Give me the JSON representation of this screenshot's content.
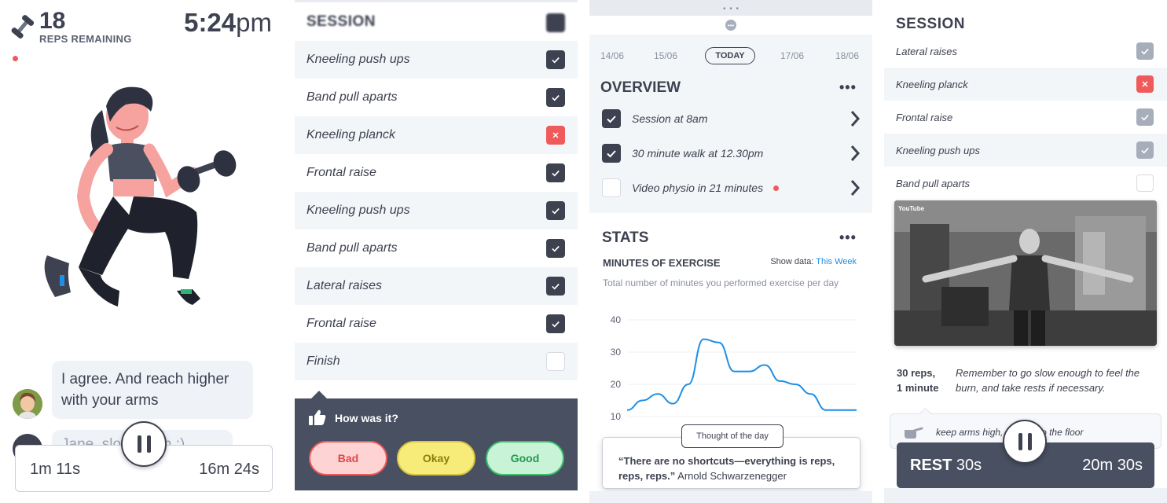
{
  "panel1": {
    "reps_count": "18",
    "reps_label": "REPS REMAINING",
    "time_main": "5:24",
    "time_suffix": "pm",
    "chat": {
      "message1": "I agree. And reach higher with your arms",
      "message2": "Jane, slow down :)"
    },
    "timer_left": "1m 11s",
    "timer_right": "16m 24s"
  },
  "panel2": {
    "title": "SESSION",
    "items": [
      {
        "label": "Kneeling push ups",
        "state": "checked"
      },
      {
        "label": "Band pull aparts",
        "state": "checked"
      },
      {
        "label": "Kneeling planck",
        "state": "failed"
      },
      {
        "label": "Frontal raise",
        "state": "checked"
      },
      {
        "label": "Kneeling push ups",
        "state": "checked"
      },
      {
        "label": "Band pull aparts",
        "state": "checked"
      },
      {
        "label": "Lateral raises",
        "state": "checked"
      },
      {
        "label": "Frontal raise",
        "state": "checked"
      },
      {
        "label": "Finish",
        "state": "unchecked"
      }
    ],
    "feedback": {
      "question": "How was it?",
      "bad": "Bad",
      "okay": "Okay",
      "good": "Good"
    }
  },
  "panel3": {
    "dates": [
      "14/06",
      "15/06",
      "TODAY",
      "17/06",
      "18/06"
    ],
    "overview_title": "OVERVIEW",
    "overview_items": [
      {
        "label": "Session at 8am",
        "checked": true
      },
      {
        "label": "30 minute walk at 12.30pm",
        "checked": true
      },
      {
        "label": "Video physio in 21 minutes",
        "checked": false,
        "alert": true
      }
    ],
    "stats_title": "STATS",
    "metric_title": "MINUTES OF EXERCISE",
    "show_data_label": "Show data:",
    "show_data_value": "This Week",
    "chart_description": "Total number of minutes you performed exercise per day",
    "thought_label": "Thought of the day",
    "quote_text": "“There are no shortcuts—everything is reps, reps, reps.”",
    "quote_author": "Arnold Schwarzenegger",
    "chart_data": {
      "type": "line",
      "title": "",
      "xlabel": "",
      "ylabel": "",
      "y_ticks": [
        40,
        30,
        20,
        10
      ],
      "ylim": [
        10,
        40
      ],
      "grid": true,
      "color": "#1d8fe6",
      "x": [
        0,
        1,
        2,
        3,
        4,
        5,
        6,
        7,
        8,
        9,
        10,
        11,
        12,
        13,
        14,
        15
      ],
      "values": [
        12,
        15,
        17,
        14,
        20,
        34,
        33,
        24,
        24,
        26,
        21,
        20,
        17,
        12,
        12,
        12
      ]
    }
  },
  "panel4": {
    "title": "SESSION",
    "items": [
      {
        "label": "Lateral raises",
        "state": "checked"
      },
      {
        "label": "Kneeling planck",
        "state": "failed"
      },
      {
        "label": "Frontal raise",
        "state": "checked"
      },
      {
        "label": "Kneeling push ups",
        "state": "checked"
      },
      {
        "label": "Band pull aparts",
        "state": "unchecked"
      }
    ],
    "video_logo": "YouTube",
    "reps_line1": "30 reps,",
    "reps_line2": "1 minute",
    "instruction": "Remember to go slow enough to feel the burn, and take rests if necessary.",
    "tip": "keep arms high, parallel to the floor",
    "rest_label": "REST",
    "rest_time": "30s",
    "remaining": "20m 30s"
  },
  "colors": {
    "primary_dark": "#3d4150",
    "failed_red": "#ef5a5a",
    "accent_blue": "#1d8fe6"
  }
}
